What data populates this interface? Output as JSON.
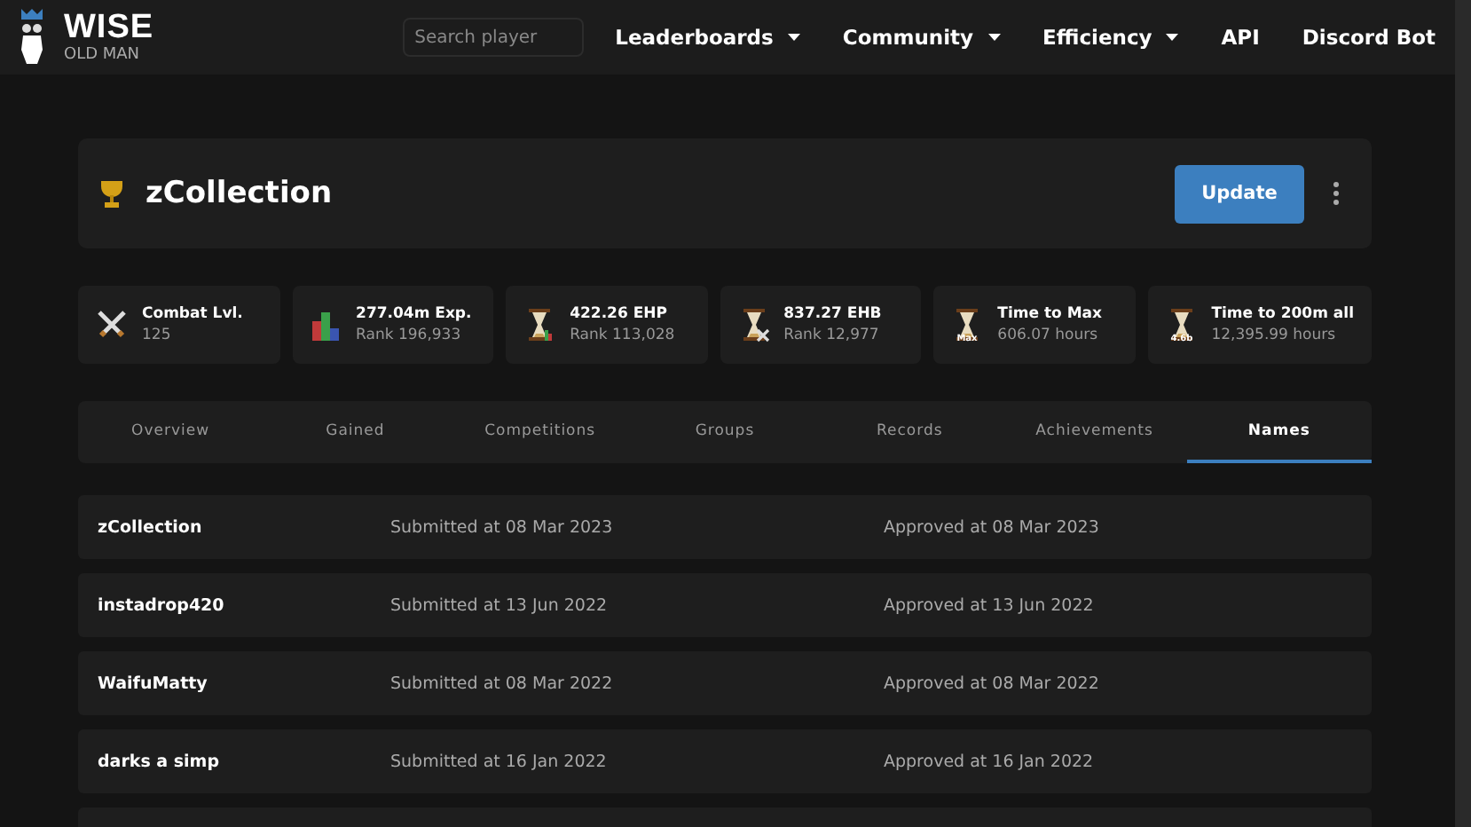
{
  "brand": {
    "title": "WISE",
    "subtitle": "OLD MAN"
  },
  "search": {
    "placeholder": "Search player"
  },
  "nav": [
    {
      "label": "Leaderboards",
      "dropdown": true
    },
    {
      "label": "Community",
      "dropdown": true
    },
    {
      "label": "Efficiency",
      "dropdown": true
    },
    {
      "label": "API",
      "dropdown": false
    },
    {
      "label": "Discord Bot",
      "dropdown": false
    }
  ],
  "player": {
    "name": "zCollection",
    "update_button": "Update"
  },
  "stats": [
    {
      "kind": "combat",
      "title": "Combat Lvl.",
      "value": "125"
    },
    {
      "kind": "exp",
      "title": "277.04m Exp.",
      "value": "Rank 196,933"
    },
    {
      "kind": "ehp",
      "title": "422.26 EHP",
      "value": "Rank 113,028"
    },
    {
      "kind": "ehb",
      "title": "837.27 EHB",
      "value": "Rank 12,977"
    },
    {
      "kind": "max",
      "badge": "Max",
      "title": "Time to Max",
      "value": "606.07 hours"
    },
    {
      "kind": "all",
      "badge": "4.6b",
      "title": "Time to 200m all",
      "value": "12,395.99 hours"
    }
  ],
  "tabs": [
    {
      "label": "Overview",
      "selected": false
    },
    {
      "label": "Gained",
      "selected": false
    },
    {
      "label": "Competitions",
      "selected": false
    },
    {
      "label": "Groups",
      "selected": false
    },
    {
      "label": "Records",
      "selected": false
    },
    {
      "label": "Achievements",
      "selected": false
    },
    {
      "label": "Names",
      "selected": true
    }
  ],
  "names": [
    {
      "name": "zCollection",
      "submitted": "Submitted at 08 Mar 2023",
      "approved": "Approved at 08 Mar 2023"
    },
    {
      "name": "instadrop420",
      "submitted": "Submitted at 13 Jun 2022",
      "approved": "Approved at 13 Jun 2022"
    },
    {
      "name": "WaifuMatty",
      "submitted": "Submitted at 08 Mar 2022",
      "approved": "Approved at 08 Mar 2022"
    },
    {
      "name": "darks a simp",
      "submitted": "Submitted at 16 Jan 2022",
      "approved": "Approved at 16 Jan 2022"
    }
  ]
}
